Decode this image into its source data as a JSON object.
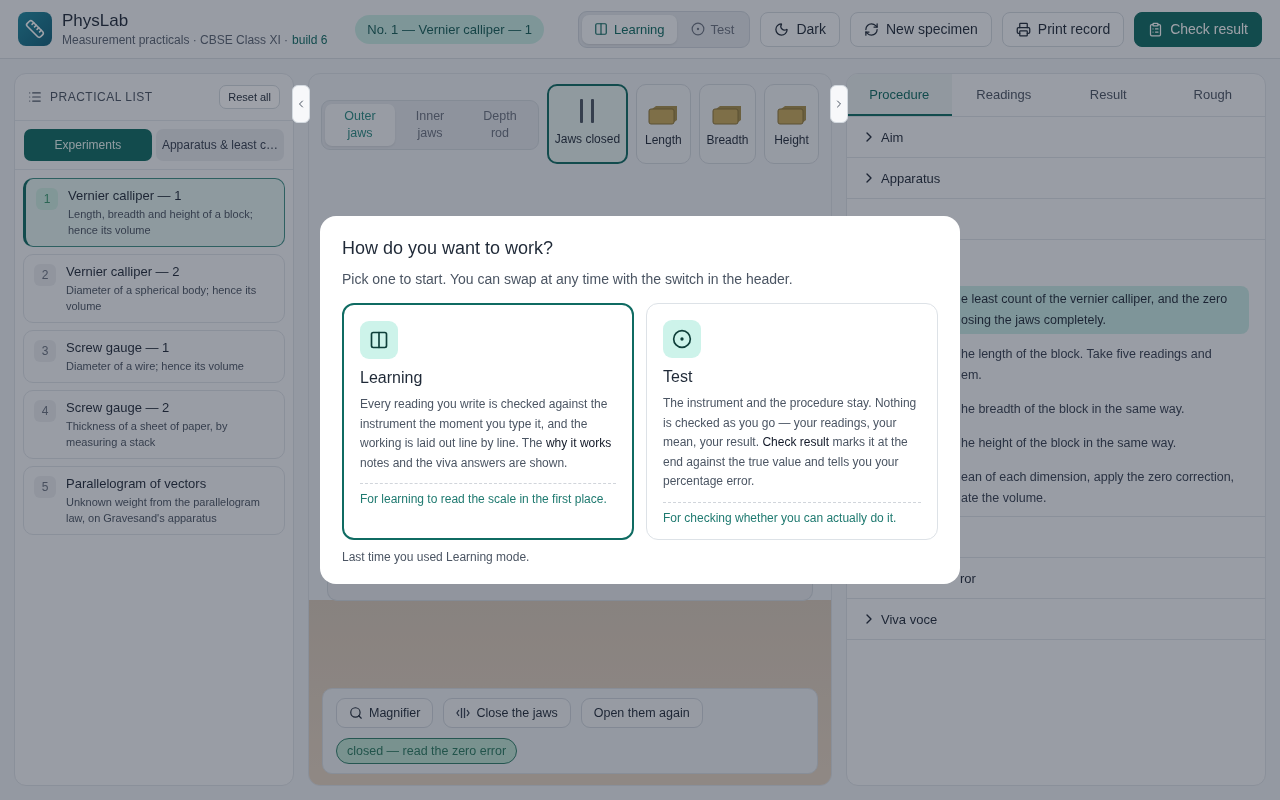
{
  "header": {
    "app_name": "PhysLab",
    "subtitle": "Measurement practicals · CBSE Class XI ·",
    "build": "build 6",
    "current_practical": "No. 1 — Vernier calliper — 1",
    "modes": [
      {
        "label": "Learning",
        "kind": "columns",
        "selected": true
      },
      {
        "label": "Test",
        "kind": "target",
        "selected": false
      }
    ],
    "actions": [
      {
        "label": "Dark",
        "kind": "moon",
        "primary": false
      },
      {
        "label": "New specimen",
        "kind": "refresh",
        "primary": false
      },
      {
        "label": "Print record",
        "kind": "printer",
        "primary": false
      },
      {
        "label": "Check result",
        "kind": "clipboard",
        "primary": true
      }
    ]
  },
  "practical_list": {
    "title": "PRACTICAL LIST",
    "reset": "Reset all",
    "tabs": [
      {
        "label": "Experiments",
        "selected": true
      },
      {
        "label": "Apparatus & least c…",
        "selected": false
      }
    ],
    "items": [
      {
        "number": "1",
        "title": "Vernier calliper — 1",
        "description": "Length, breadth and height of a block; hence its volume",
        "selected": true
      },
      {
        "number": "2",
        "title": "Vernier calliper — 2",
        "description": "Diameter of a spherical body; hence its volume",
        "selected": false
      },
      {
        "number": "3",
        "title": "Screw gauge — 1",
        "description": "Diameter of a wire; hence its volume",
        "selected": false
      },
      {
        "number": "4",
        "title": "Screw gauge — 2",
        "description": "Thickness of a sheet of paper, by measuring a stack",
        "selected": false
      },
      {
        "number": "5",
        "title": "Parallelogram of vectors",
        "description": "Unknown weight from the parallelogram law, on Gravesand's apparatus",
        "selected": false
      }
    ]
  },
  "workbench": {
    "jaw_tabs": [
      {
        "label": "Outer jaws",
        "selected": true
      },
      {
        "label": "Inner jaws",
        "selected": false
      },
      {
        "label": "Depth rod",
        "selected": false
      }
    ],
    "views": [
      {
        "label": "Jaws closed",
        "kind": "jaws",
        "selected": true
      },
      {
        "label": "Length",
        "kind": "block",
        "selected": false
      },
      {
        "label": "Breadth",
        "kind": "block",
        "selected": false
      },
      {
        "label": "Height",
        "kind": "block",
        "selected": false
      }
    ],
    "controls": [
      {
        "label": "Magnifier",
        "kind": "search"
      },
      {
        "label": "Close the jaws",
        "kind": "jaws"
      },
      {
        "label": "Open them again",
        "kind": "plain"
      }
    ],
    "status": "closed — read the zero error"
  },
  "side_panel": {
    "tabs": [
      {
        "label": "Procedure",
        "selected": true
      },
      {
        "label": "Readings",
        "selected": false
      },
      {
        "label": "Result",
        "selected": false
      },
      {
        "label": "Rough",
        "selected": false
      }
    ],
    "sections_before": [
      {
        "label": "Aim",
        "expanded": false
      },
      {
        "label": "Apparatus",
        "expanded": false
      }
    ],
    "procedure_steps": [
      {
        "text": "e least count of the vernier calliper, and the zero\nosing the jaws completely.",
        "selected": true
      },
      {
        "text": "he length of the block. Take five readings and\nem.",
        "selected": false
      },
      {
        "text": "he breadth of the block in the same way.",
        "selected": false
      },
      {
        "text": "he height of the block in the same way.",
        "selected": false
      },
      {
        "text": "ean of each dimension, apply the zero correction,\nate the volume.",
        "selected": false
      }
    ],
    "sections_after": [
      {
        "label": "ror",
        "covered": true
      },
      {
        "label": "Viva voce",
        "covered": false
      }
    ]
  },
  "dialog": {
    "title": "How do you want to work?",
    "subtitle": "Pick one to start. You can swap at any time with the switch in the header.",
    "options": [
      {
        "title": "Learning",
        "kind": "columns",
        "selected": true,
        "body": "Every reading you write is checked against the instrument the moment you type it, and the working is laid out line by line. The **why it works** notes and the viva answers are shown.",
        "note": "For learning to read the scale in the first place."
      },
      {
        "title": "Test",
        "kind": "target",
        "selected": false,
        "body": "The instrument and the procedure stay. Nothing is checked as you go — your readings, your mean, your result. **Check result** marks it at the end against the true value and tells you your percentage error.",
        "note": "For checking whether you can actually do it."
      }
    ],
    "footer": "Last time you used Learning mode."
  }
}
